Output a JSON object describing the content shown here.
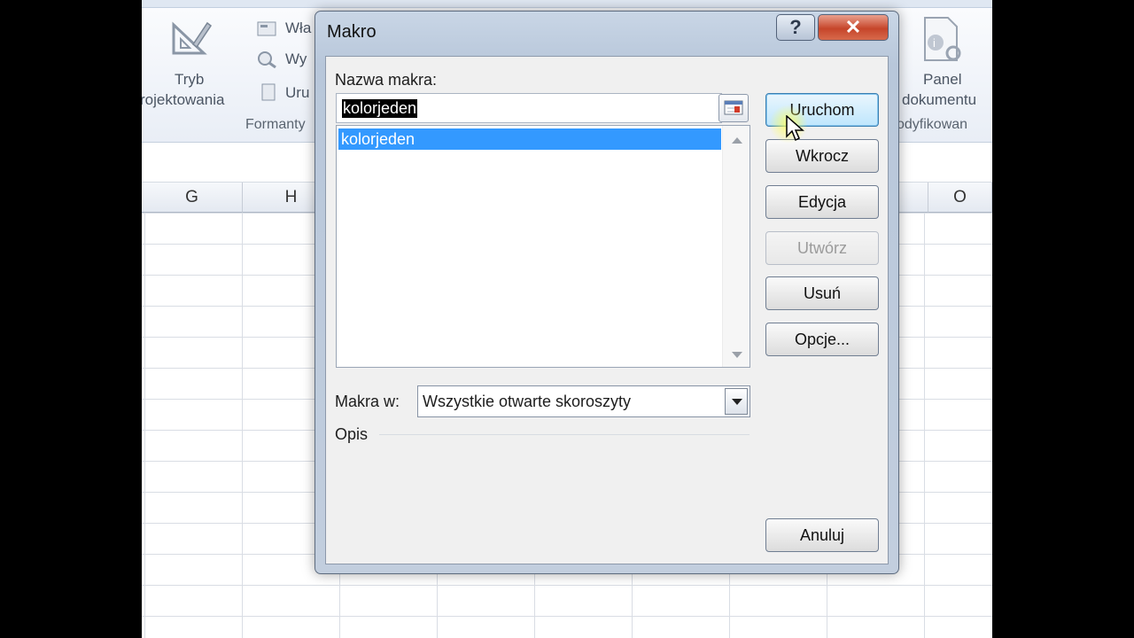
{
  "ribbon": {
    "tryb_line1": "Tryb",
    "tryb_line2": "rojektowania",
    "item1": "Wła",
    "item2": "Wy",
    "item3": "Uru",
    "group_formanty": "Formanty",
    "panel_line1": "Panel",
    "panel_line2": "dokumentu",
    "group_right": "odyfikowan"
  },
  "sheet": {
    "columns_left": [
      "G",
      "H"
    ],
    "column_right": "O"
  },
  "dialog": {
    "title": "Makro",
    "help_label": "?",
    "close_label": "✕",
    "macro_name_label": "Nazwa makra:",
    "macro_name_value": "kolorjeden",
    "macros": [
      "kolorjeden"
    ],
    "macros_in_label": "Makra w:",
    "macros_in_value": "Wszystkie otwarte skoroszyty",
    "description_label": "Opis",
    "buttons": {
      "run": "Uruchom",
      "step_into": "Wkrocz",
      "edit": "Edycja",
      "create": "Utwórz",
      "delete": "Usuń",
      "options": "Opcje...",
      "cancel": "Anuluj"
    }
  },
  "colors": {
    "selection": "#3399ff",
    "primary_button": "#bee6fd",
    "close_button": "#c6452a"
  }
}
